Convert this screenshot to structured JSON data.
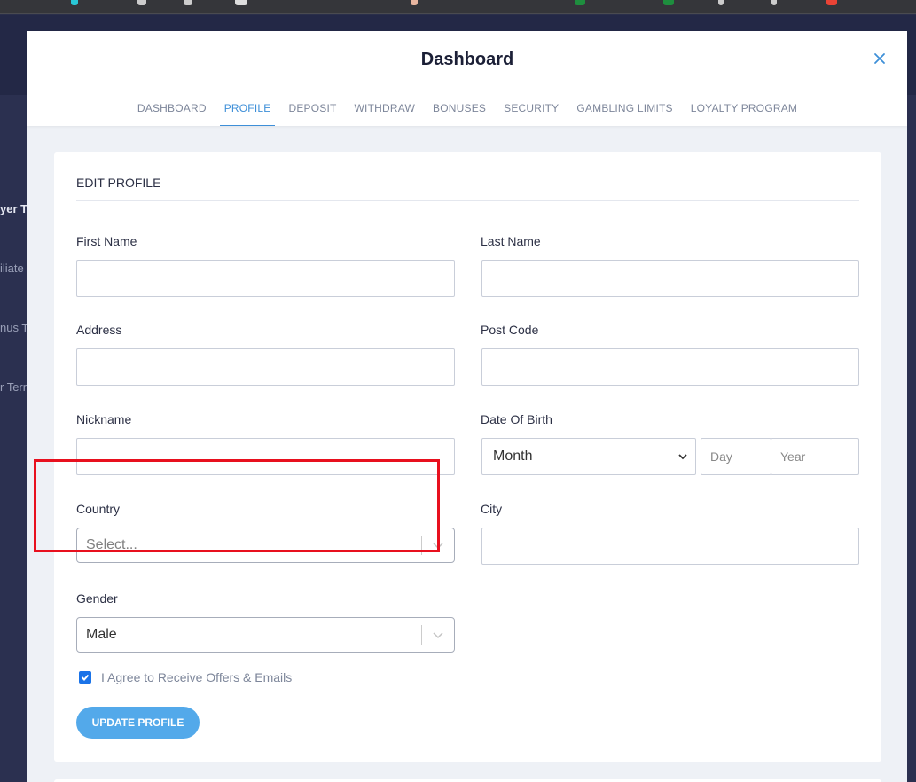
{
  "background": {
    "side_texts": [
      "yer T",
      "iliate",
      "nus T",
      "r Terr"
    ]
  },
  "modal": {
    "title": "Dashboard",
    "tabs": [
      {
        "label": "DASHBOARD"
      },
      {
        "label": "PROFILE"
      },
      {
        "label": "DEPOSIT"
      },
      {
        "label": "WITHDRAW"
      },
      {
        "label": "BONUSES"
      },
      {
        "label": "SECURITY"
      },
      {
        "label": "GAMBLING LIMITS"
      },
      {
        "label": "LOYALTY PROGRAM"
      }
    ],
    "active_tab": "PROFILE"
  },
  "form": {
    "section_title": "EDIT PROFILE",
    "first_name": {
      "label": "First Name",
      "value": ""
    },
    "last_name": {
      "label": "Last Name",
      "value": ""
    },
    "address": {
      "label": "Address",
      "value": ""
    },
    "post_code": {
      "label": "Post Code",
      "value": ""
    },
    "nickname": {
      "label": "Nickname",
      "value": ""
    },
    "dob": {
      "label": "Date Of Birth",
      "month_value": "Month",
      "day_placeholder": "Day",
      "year_placeholder": "Year"
    },
    "country": {
      "label": "Country",
      "placeholder": "Select..."
    },
    "city": {
      "label": "City",
      "value": ""
    },
    "gender": {
      "label": "Gender",
      "value": "Male"
    },
    "offers": {
      "label": "I Agree to Receive Offers & Emails",
      "checked": true
    },
    "submit_label": "UPDATE PROFILE"
  },
  "colors": {
    "accent": "#3e8fd8",
    "button": "#53a9ea",
    "highlight": "#e8101e",
    "checkbox": "#1a73e8"
  }
}
